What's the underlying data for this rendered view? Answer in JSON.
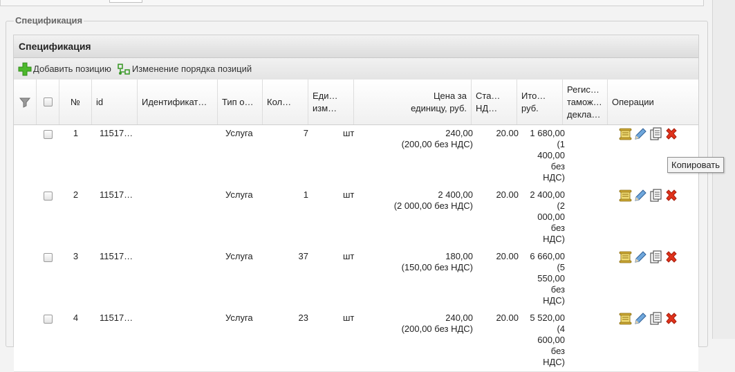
{
  "fieldset_legend": "Спецификация",
  "grid": {
    "title": "Спецификация",
    "toolbar": {
      "add": "Добавить позицию",
      "reorder": "Изменение порядка позиций"
    },
    "columns": {
      "num": "№",
      "id": "id",
      "ident": "Идентификат…",
      "type": "Тип о…",
      "qty": "Кол…",
      "unit": [
        "Еди…",
        "изм…"
      ],
      "price": [
        "Цена за",
        "единицу, руб."
      ],
      "rate": [
        "Ста…",
        "НД…"
      ],
      "total": [
        "Ито…",
        "руб."
      ],
      "reg": [
        "Регис…",
        "тамож…",
        "декла…"
      ],
      "ops": "Операции"
    },
    "rows": [
      {
        "num": "1",
        "id": "11517…",
        "type": "Услуга",
        "qty": "7",
        "unit": "шт",
        "price": [
          "240,00",
          "(200,00 без НДС)"
        ],
        "rate": "20.00",
        "total": [
          "1 680,00",
          "(1",
          "400,00",
          "без",
          "НДС)"
        ]
      },
      {
        "num": "2",
        "id": "11517…",
        "type": "Услуга",
        "qty": "1",
        "unit": "шт",
        "price": [
          "2 400,00",
          "(2 000,00 без НДС)"
        ],
        "rate": "20.00",
        "total": [
          "2 400,00",
          "(2",
          "000,00",
          "без",
          "НДС)"
        ]
      },
      {
        "num": "3",
        "id": "11517…",
        "type": "Услуга",
        "qty": "37",
        "unit": "шт",
        "price": [
          "180,00",
          "(150,00 без НДС)"
        ],
        "rate": "20.00",
        "total": [
          "6 660,00",
          "(5",
          "550,00",
          "без",
          "НДС)"
        ]
      },
      {
        "num": "4",
        "id": "11517…",
        "type": "Услуга",
        "qty": "23",
        "unit": "шт",
        "price": [
          "240,00",
          "(200,00 без НДС)"
        ],
        "rate": "20.00",
        "total": [
          "5 520,00",
          "(4",
          "600,00",
          "без",
          "НДС)"
        ]
      }
    ]
  },
  "tooltip": "Копировать",
  "icons": {
    "filter": "filter-icon",
    "add": "plus-icon",
    "reorder": "reorder-icon",
    "scroll": "scroll-icon",
    "edit": "pencil-icon",
    "copy": "copy-icon",
    "delete": "delete-icon"
  },
  "colors": {
    "add": "#4cb82c",
    "delete": "#e0321b",
    "scroll": "#d3b53a",
    "edit": "#3f7fc2"
  }
}
